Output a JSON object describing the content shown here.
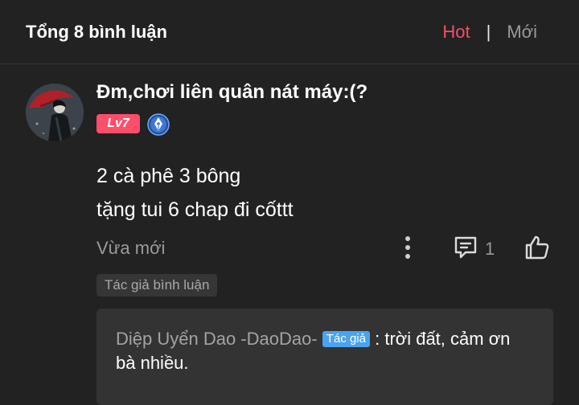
{
  "header": {
    "title": "Tổng 8 bình luận",
    "tabs": {
      "hot": "Hot",
      "separator": "|",
      "new": "Mới"
    }
  },
  "comment": {
    "username": "Đm,chơi liên quân nát máy:(?",
    "level": "Lv7",
    "badge_icon": "pen-nib-icon",
    "lines": [
      "2 cà phê 3 bông",
      "tặng tui 6 chap đi cốttt"
    ],
    "time": "Vừa mới",
    "reply_count": "1",
    "author_tag": "Tác giả bình luận"
  },
  "reply": {
    "author": "Diệp Uyển Dao -DaoDao-",
    "author_chip": "Tác giả",
    "text": ": trời đất, cảm ơn bà nhiều."
  },
  "colors": {
    "background": "#222222",
    "accent_hot": "#f0506e",
    "level_badge": "#ff4d6a",
    "author_chip": "#4aa3f0",
    "reply_box": "#333333"
  }
}
